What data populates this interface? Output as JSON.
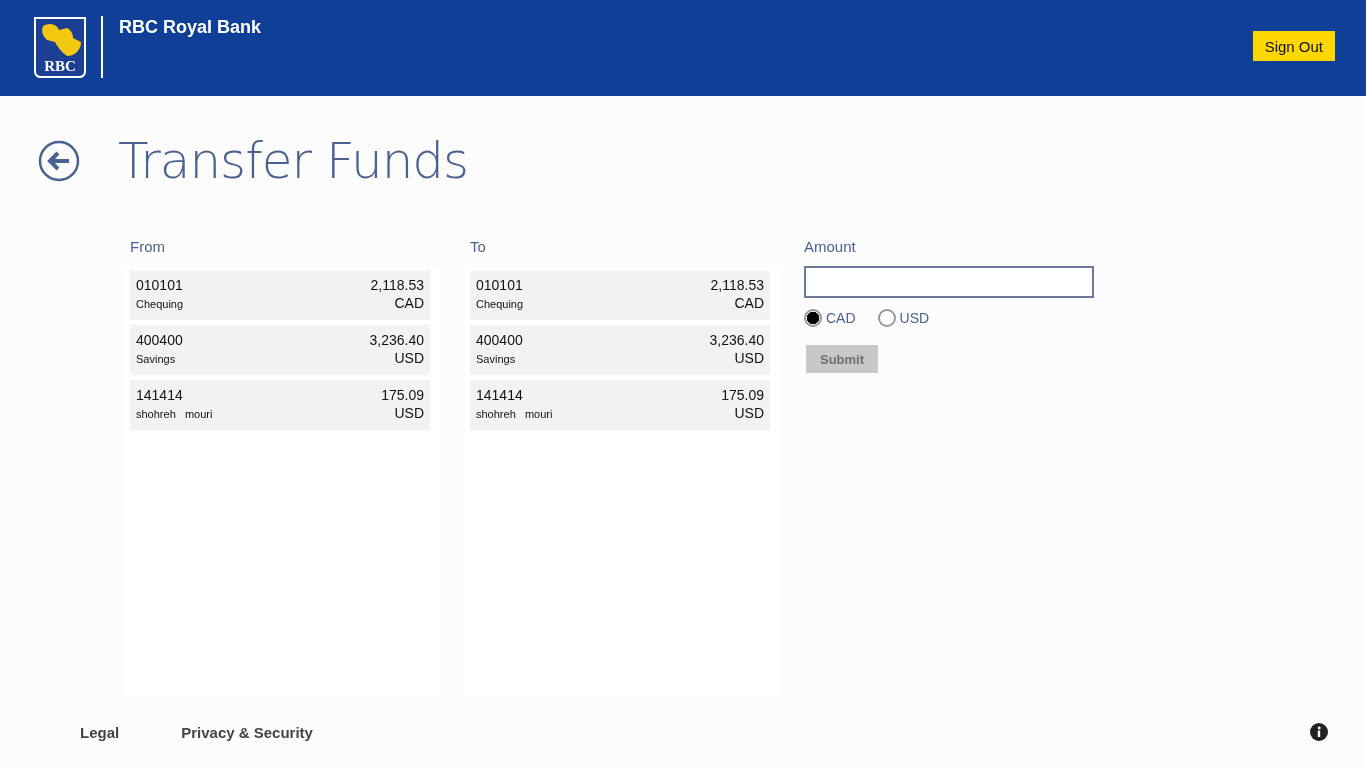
{
  "header": {
    "logo_text": "RBC",
    "bank_name": "RBC Royal Bank",
    "sign_out": "Sign Out"
  },
  "page": {
    "title": "Transfer Funds"
  },
  "from": {
    "label": "From",
    "accounts": [
      {
        "number": "010101",
        "name": "Chequing",
        "balance": "2,118.53",
        "currency": "CAD",
        "selected": false
      },
      {
        "number": "400400",
        "name": "Savings",
        "balance": "3,236.40",
        "currency": "USD",
        "selected": false
      },
      {
        "number": "141414",
        "name": "shohreh   mouri",
        "balance": "175.09",
        "currency": "USD",
        "selected": false
      }
    ]
  },
  "to": {
    "label": "To",
    "accounts": [
      {
        "number": "010101",
        "name": "Chequing",
        "balance": "2,118.53",
        "currency": "CAD",
        "selected": false
      },
      {
        "number": "400400",
        "name": "Savings",
        "balance": "3,236.40",
        "currency": "USD",
        "selected": false
      },
      {
        "number": "141414",
        "name": "shohreh   mouri",
        "balance": "175.09",
        "currency": "USD",
        "selected": false
      }
    ]
  },
  "amount": {
    "label": "Amount",
    "currencies": [
      {
        "label": "CAD",
        "selected": true
      },
      {
        "label": "USD",
        "selected": false
      }
    ],
    "submit": {
      "label": "Submit",
      "disabled": true
    }
  },
  "footer": {
    "links": [
      "Legal",
      "Privacy & Security"
    ]
  }
}
